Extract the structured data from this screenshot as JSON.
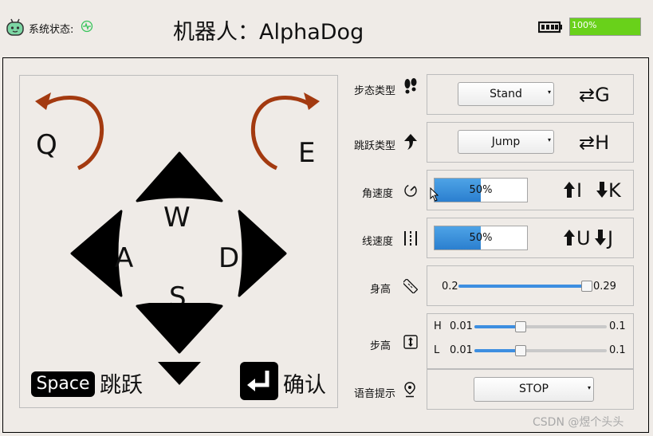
{
  "header": {
    "status_label": "系统状态:",
    "robot_title": "机器人：AlphaDog",
    "battery_percent": 100,
    "battery_text": "100%",
    "icons": {
      "robot": "robot-icon",
      "status": "heartbeat-icon",
      "battery": "battery-icon"
    }
  },
  "pad": {
    "rotate_left_key": "Q",
    "rotate_right_key": "E",
    "up_key": "W",
    "left_key": "A",
    "right_key": "D",
    "down_key": "S",
    "space_key": "Space",
    "jump_label": "跳跃",
    "confirm_label": "确认"
  },
  "gait": {
    "label": "步态类型",
    "value": "Stand",
    "hint": "⇄G",
    "icon": "footprints-icon"
  },
  "jump": {
    "label": "跳跃类型",
    "value": "Jump",
    "hint": "⇄H",
    "icon": "jump-arrow-icon"
  },
  "angular_speed": {
    "label": "角速度",
    "percent": 50,
    "text": "50%",
    "hint_up": "I",
    "hint_down": "K",
    "icon": "rotation-speed-icon"
  },
  "linear_speed": {
    "label": "线速度",
    "percent": 50,
    "text": "50%",
    "hint_up": "U",
    "hint_down": "J",
    "icon": "linear-speed-icon"
  },
  "height": {
    "label": "身高",
    "min": "0.2",
    "max": "0.29",
    "value_fraction": 1.0,
    "icon": "ruler-icon"
  },
  "step_height": {
    "label": "步高",
    "h_label": "H",
    "h_min": "0.01",
    "h_max": "0.1",
    "h_fraction": 0.33,
    "l_label": "L",
    "l_min": "0.01",
    "l_max": "0.1",
    "l_fraction": 0.33,
    "icon": "vertical-resize-icon"
  },
  "voice": {
    "label": "语音提示",
    "value": "STOP",
    "icon": "location-pin-icon"
  },
  "watermark": "CSDN @煜个头头",
  "colors": {
    "arrow_red": "#a33a10",
    "battery_green": "#69d11a",
    "progress_blue": "#3d8ee0"
  }
}
